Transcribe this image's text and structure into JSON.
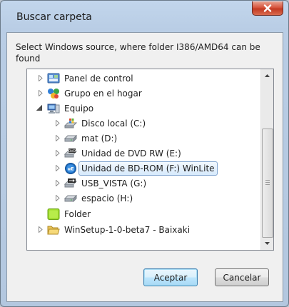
{
  "window": {
    "title": "Buscar carpeta"
  },
  "instructions": "Select Windows source, where folder I386/AMD64 can be found",
  "tree": [
    {
      "label": "Panel de control",
      "icon": "control-panel-icon",
      "expander": "collapsed",
      "level": 0,
      "selected": false
    },
    {
      "label": "Grupo en el hogar",
      "icon": "homegroup-icon",
      "expander": "collapsed",
      "level": 0,
      "selected": false
    },
    {
      "label": "Equipo",
      "icon": "computer-icon",
      "expander": "expanded",
      "level": 0,
      "selected": false
    },
    {
      "label": "Disco local (C:)",
      "icon": "windows-drive-icon",
      "expander": "collapsed",
      "level": 1,
      "selected": false
    },
    {
      "label": "mat (D:)",
      "icon": "hard-drive-icon",
      "expander": "collapsed",
      "level": 1,
      "selected": false
    },
    {
      "label": "Unidad de DVD RW (E:)",
      "icon": "dvd-drive-icon",
      "expander": "collapsed",
      "level": 1,
      "selected": false
    },
    {
      "label": "Unidad de BD-ROM (F:) WinLite",
      "icon": "bd-rom-disc-icon",
      "expander": "collapsed",
      "level": 1,
      "selected": true
    },
    {
      "label": "USB_VISTA (G:)",
      "icon": "usb-drive-icon",
      "expander": "collapsed",
      "level": 1,
      "selected": false
    },
    {
      "label": "espacio (H:)",
      "icon": "hard-drive-icon",
      "expander": "collapsed",
      "level": 1,
      "selected": false
    },
    {
      "label": "Folder",
      "icon": "green-folder-icon",
      "expander": "none",
      "level": 0,
      "selected": false
    },
    {
      "label": "WinSetup-1-0-beta7 - Baixaki",
      "icon": "folder-icon",
      "expander": "collapsed",
      "level": 0,
      "selected": false
    }
  ],
  "buttons": {
    "accept": "Aceptar",
    "cancel": "Cancelar"
  },
  "colors": {
    "selection_border": "#7da2ce",
    "close_button": "#c23a22"
  }
}
